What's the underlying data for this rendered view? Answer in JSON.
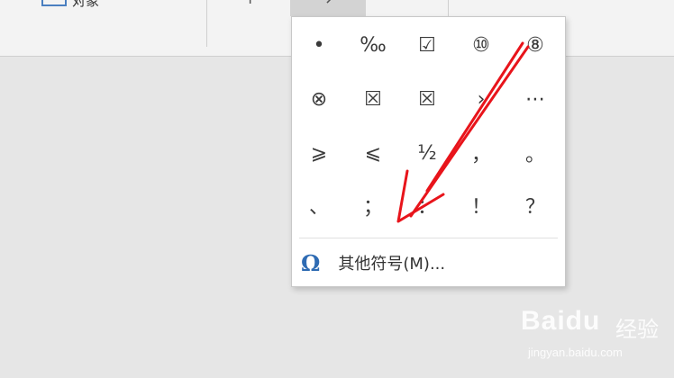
{
  "ribbon": {
    "object_button_label": "对象",
    "left_tool_glyph": "↑",
    "active_tool_glyph": "↗"
  },
  "symbol_popup": {
    "symbols": [
      "•",
      "‰",
      "☑",
      "⑩",
      "⑧",
      "⊗",
      "☒",
      "☒",
      "›",
      "⋯",
      "⩾",
      "⩽",
      "½",
      "，",
      "。",
      "、",
      "；",
      "：",
      "！",
      "？"
    ],
    "more_symbols_icon": "Ω",
    "more_symbols_label": "其他符号(M)..."
  },
  "annotation": {
    "arrow_color": "#e8141b"
  },
  "watermark": {
    "logo": "Baidu",
    "logo_cn": "经验",
    "url": "jingyan.baidu.com"
  }
}
